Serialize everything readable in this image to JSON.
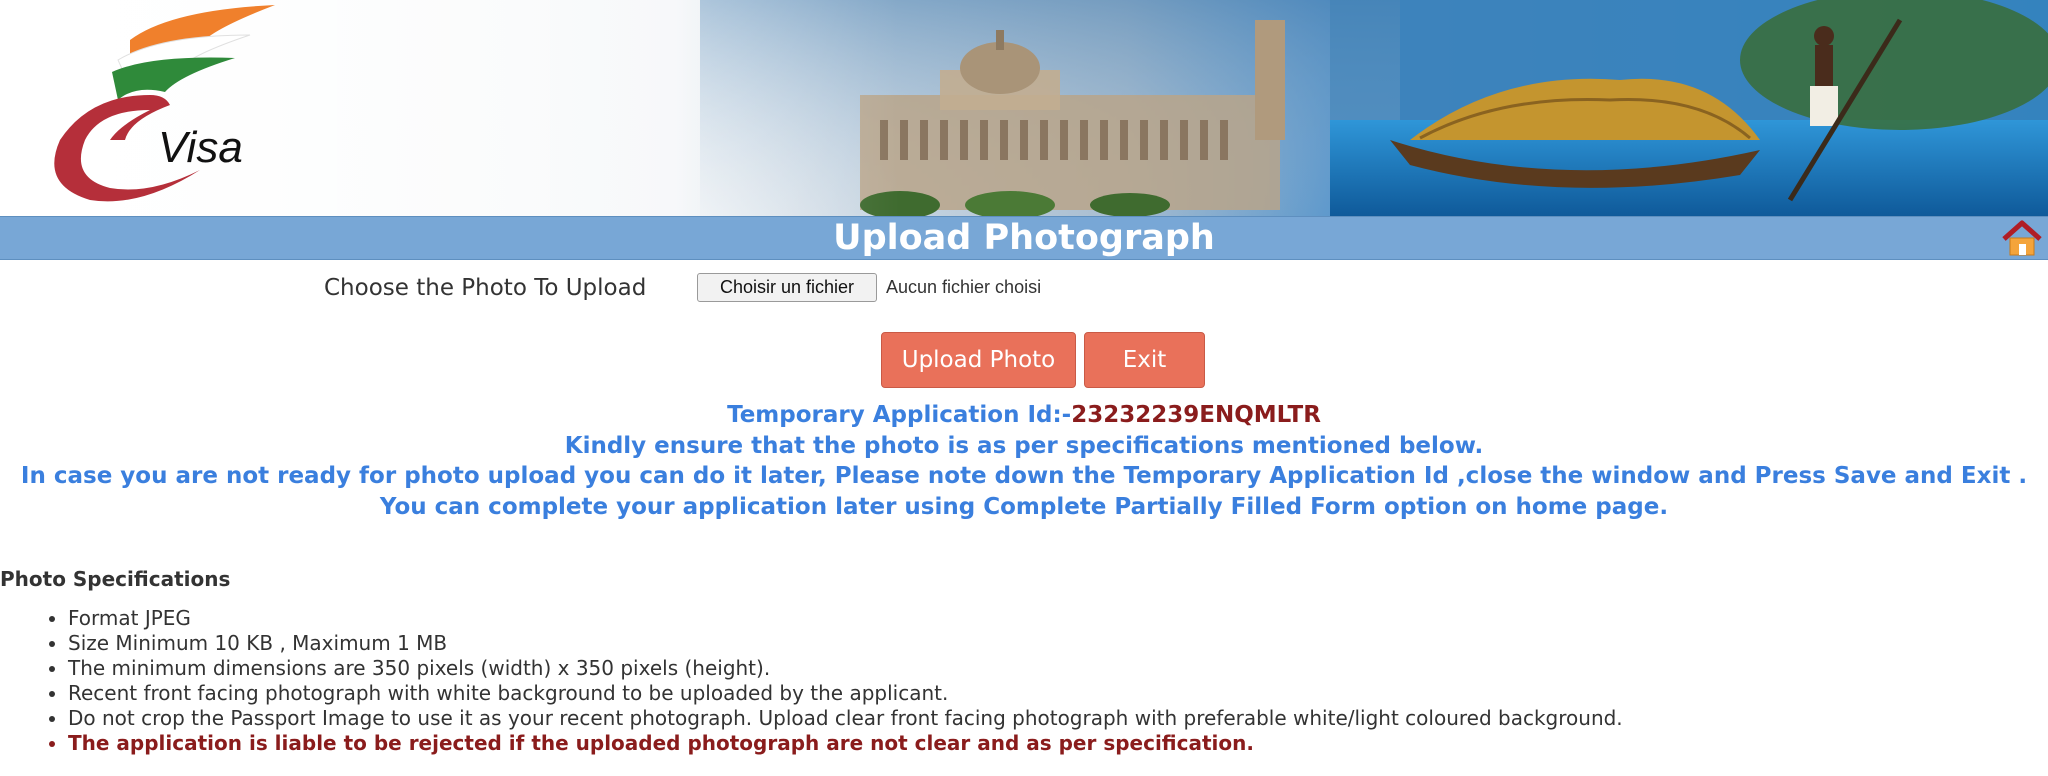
{
  "header": {
    "logo_text": "Visa",
    "page_title": "Upload Photograph"
  },
  "upload": {
    "label": "Choose the Photo To Upload",
    "file_button": "Choisir un fichier",
    "file_status": "Aucun fichier choisi",
    "upload_button": "Upload Photo",
    "exit_button": "Exit"
  },
  "notice": {
    "appid_label": "Temporary Application Id:-",
    "appid_value": "23232239ENQMLTR",
    "line1": "Kindly ensure that the photo is as per specifications mentioned below.",
    "line2": "In case you are not ready for photo upload you can do it later, Please note down the Temporary Application Id ,close the window and Press Save and Exit .",
    "line3": "You can complete your application later using Complete Partially Filled Form option on home page."
  },
  "specs": {
    "title": "Photo Specifications",
    "items": [
      "Format  JPEG",
      "Size  Minimum 10 KB , Maximum 1 MB",
      "The minimum dimensions are 350 pixels (width) x 350 pixels (height).",
      "Recent front facing photograph with white background to be uploaded by the applicant.",
      "Do not crop the Passport Image to use it as your recent photograph. Upload clear front facing photograph with preferable white/light coloured background."
    ],
    "warning": "The application is liable to be rejected if the uploaded photograph are not clear and as per specification."
  },
  "icons": {
    "home": "home-icon",
    "logo": "evisa-logo"
  },
  "colors": {
    "title_bar": "#78a7d6",
    "button": "#e9715a",
    "notice_text": "#3a7fde",
    "app_id": "#8a1c1c"
  }
}
